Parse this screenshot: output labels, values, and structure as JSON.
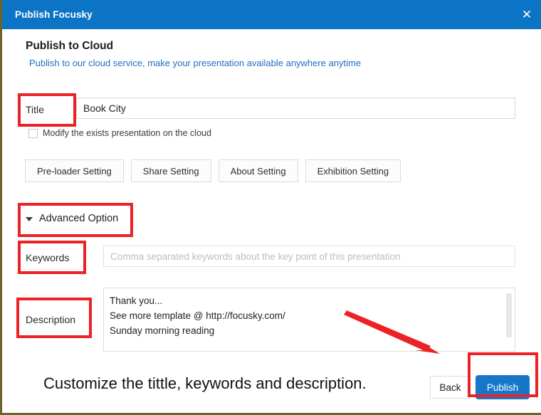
{
  "window": {
    "title": "Publish Focusky",
    "close_icon": "close-icon",
    "titlebar_color": "#0b74c4"
  },
  "header": {
    "heading": "Publish to Cloud",
    "subheading": "Publish to our cloud service, make your presentation available anywhere anytime",
    "subheading_color": "#1f6fc4"
  },
  "form": {
    "title_label": "Title",
    "title_value": "Book City",
    "title_placeholder": "",
    "modify_checkbox_label": "Modify the exists presentation on the cloud",
    "modify_checkbox_checked": false,
    "setting_buttons": [
      {
        "label": "Pre-loader Setting"
      },
      {
        "label": "Share Setting"
      },
      {
        "label": "About Setting"
      },
      {
        "label": "Exhibition Setting"
      }
    ],
    "advanced_option_label": "Advanced Option",
    "advanced_caret_icon": "chevron-down-icon",
    "advanced_expanded": true,
    "keywords_label": "Keywords",
    "keywords_value": "",
    "keywords_placeholder": "Comma separated keywords about the key point of this presentation",
    "description_label": "Description",
    "description_value": "Thank you...\nSee more template @ http://focusky.com/\nSunday morning reading"
  },
  "footer": {
    "caption": "Customize the tittle, keywords and description.",
    "back_label": "Back",
    "publish_label": "Publish",
    "publish_color": "#1676c8"
  },
  "annotations": {
    "color": "#ec2227",
    "boxes": [
      {
        "target": "title-label"
      },
      {
        "target": "advanced-option"
      },
      {
        "target": "keywords-label"
      },
      {
        "target": "description-label"
      },
      {
        "target": "publish-button"
      }
    ],
    "arrow": {
      "from": "description-field",
      "to": "publish-button"
    }
  }
}
